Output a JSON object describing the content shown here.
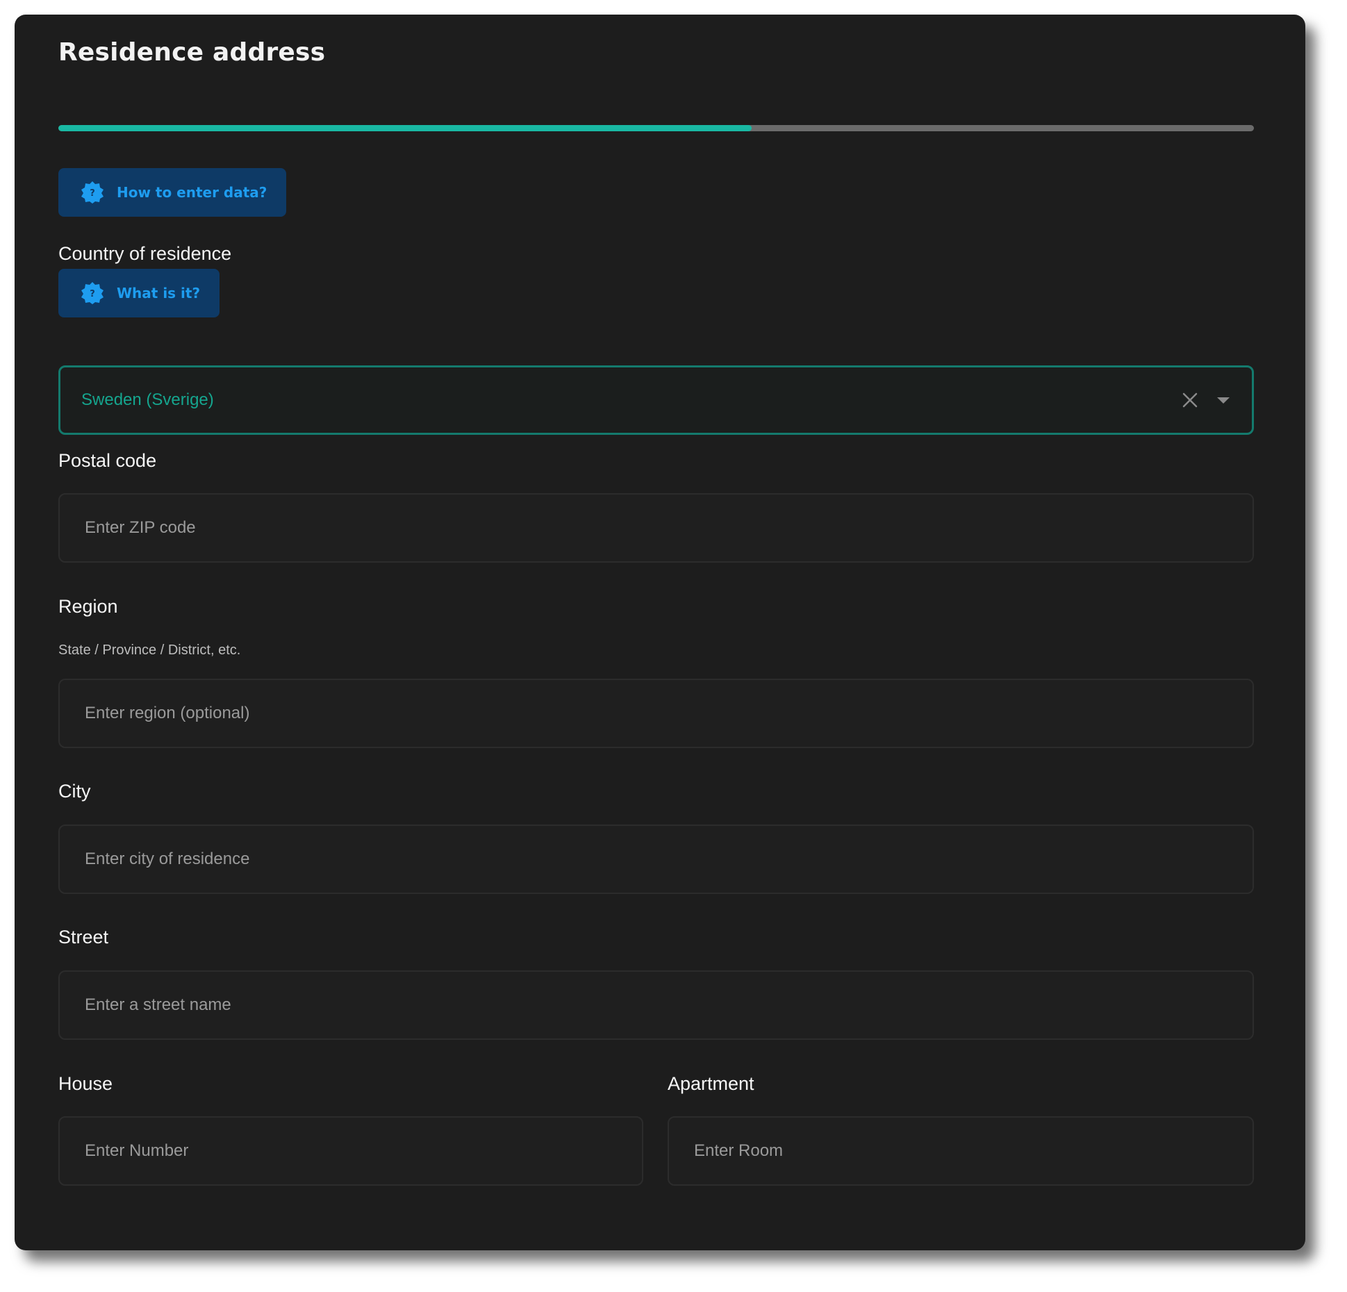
{
  "form": {
    "title": "Residence address",
    "progress_fraction": 0.58
  },
  "help": {
    "how_to_enter": "How to enter data?",
    "what_is_it": "What is it?"
  },
  "country": {
    "label": "Country of residence",
    "value": "Sweden (Sverige)"
  },
  "postal": {
    "label": "Postal code",
    "placeholder": "Enter ZIP code"
  },
  "region": {
    "label": "Region",
    "hint": "State / Province / District, etc.",
    "placeholder": "Enter region (optional)"
  },
  "city": {
    "label": "City",
    "placeholder": "Enter city of residence"
  },
  "street": {
    "label": "Street",
    "placeholder": "Enter a street name"
  },
  "house": {
    "label": "House",
    "placeholder": "Enter Number"
  },
  "apartment": {
    "label": "Apartment",
    "placeholder": "Enter Room"
  },
  "colors": {
    "accent": "#19b8a3",
    "help_bg": "#0e3a66",
    "help_text": "#1e9df0",
    "panel_bg": "#1d1d1d"
  },
  "icons": {
    "help": "question-badge-icon",
    "clear": "close-icon",
    "dropdown": "chevron-down-icon"
  }
}
